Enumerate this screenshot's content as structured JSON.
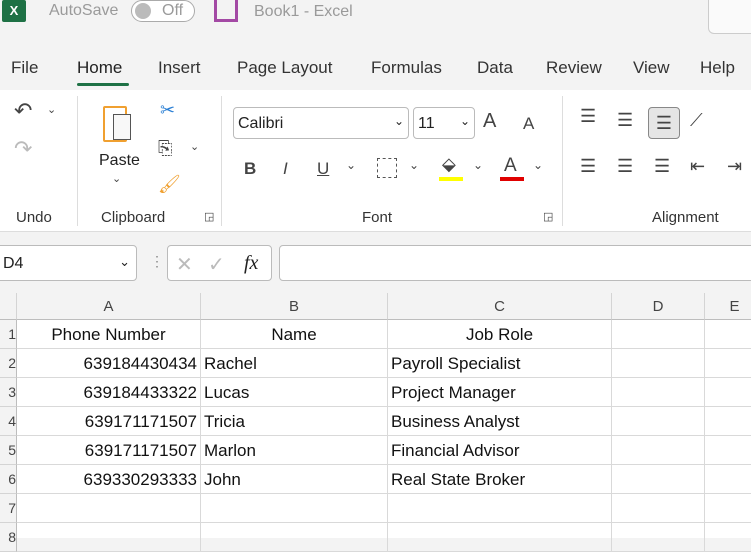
{
  "titlebar": {
    "autosave_label": "AutoSave",
    "autosave_state": "Off",
    "doc_title": "Book1  -  Excel",
    "logo": "X"
  },
  "tabs": [
    "File",
    "Home",
    "Insert",
    "Page Layout",
    "Formulas",
    "Data",
    "Review",
    "View",
    "Help"
  ],
  "ribbon": {
    "groups": {
      "undo": "Undo",
      "clipboard": "Clipboard",
      "font": "Font",
      "alignment": "Alignment"
    },
    "paste_label": "Paste",
    "font_name": "Calibri",
    "font_size": "11",
    "bold": "B",
    "italic": "I",
    "underline": "U",
    "grow": "A",
    "shrink": "A",
    "font_color_letter": "A"
  },
  "formula_bar": {
    "name_box": "D4",
    "fx": "fx",
    "value": ""
  },
  "sheet": {
    "columns": [
      "A",
      "B",
      "C",
      "D",
      "E"
    ],
    "rows": [
      "1",
      "2",
      "3",
      "4",
      "5",
      "6",
      "7",
      "8"
    ],
    "cells": [
      [
        "Phone Number",
        "Name",
        "Job Role"
      ],
      [
        "639184430434",
        "Rachel",
        "Payroll Specialist"
      ],
      [
        "639184433322",
        "Lucas",
        "Project Manager"
      ],
      [
        "639171171507",
        "Tricia",
        "Business Analyst"
      ],
      [
        "639171171507",
        "Marlon",
        "Financial Advisor"
      ],
      [
        "639330293333",
        "John",
        "Real State Broker"
      ]
    ]
  },
  "colors": {
    "accent": "#1e7145",
    "highlight": "#ffff00",
    "font_color": "#e00000"
  }
}
